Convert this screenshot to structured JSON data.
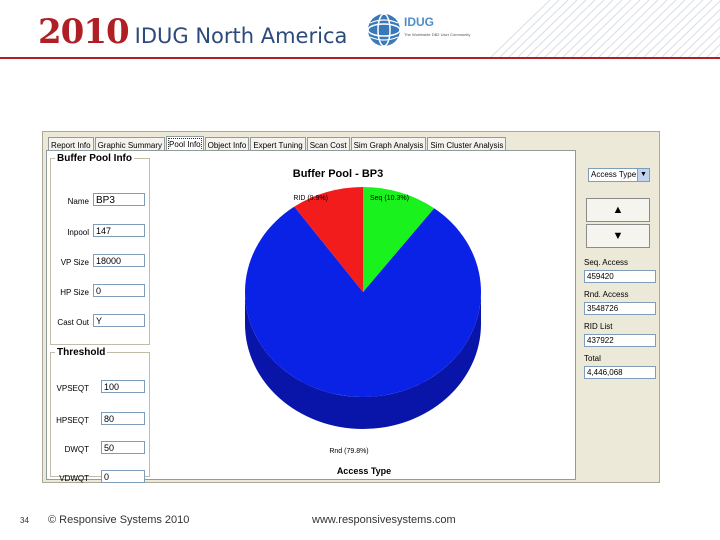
{
  "header": {
    "year": "2010",
    "conference": "IDUG North America",
    "logo_text": "IDUG",
    "logo_tagline": "The Worldwide DB2 User Community"
  },
  "tabs": [
    {
      "label": "Report Info"
    },
    {
      "label": "Graphic Summary"
    },
    {
      "label": "Pool Info",
      "active": true
    },
    {
      "label": "Object Info"
    },
    {
      "label": "Expert Tuning"
    },
    {
      "label": "Scan Cost"
    },
    {
      "label": "Sim Graph Analysis"
    },
    {
      "label": "Sim Cluster Analysis"
    }
  ],
  "buffer_pool_info": {
    "title": "Buffer Pool Info",
    "fields": [
      {
        "label": "Name",
        "value": "BP3"
      },
      {
        "label": "Inpool",
        "value": "147"
      },
      {
        "label": "VP Size",
        "value": "18000"
      },
      {
        "label": "HP Size",
        "value": "0"
      },
      {
        "label": "Cast Out",
        "value": "Y"
      }
    ]
  },
  "threshold": {
    "title": "Threshold",
    "fields": [
      {
        "label": "VPSEQT",
        "value": "100"
      },
      {
        "label": "HPSEQT",
        "value": "80"
      },
      {
        "label": "DWQT",
        "value": "50"
      },
      {
        "label": "VDWQT",
        "value": "0"
      }
    ]
  },
  "chart_data": {
    "type": "pie",
    "title": "Buffer Pool - BP3",
    "xlabel": "Access Type",
    "categories": [
      "Rnd",
      "Seq",
      "RID"
    ],
    "values": [
      79.8,
      10.3,
      9.9
    ],
    "labels": [
      "Rnd (79.8%)",
      "Seq (10.3%)",
      "RID (9.9%)"
    ],
    "colors": [
      "#0a22e6",
      "#19f21c",
      "#f21c1c"
    ],
    "colors_dark": [
      "#0915a8",
      "#12b015",
      "#b01212"
    ],
    "style": "3d"
  },
  "right_panel": {
    "combo_value": "Access Type",
    "up_glyph": "▲",
    "down_glyph": "▼",
    "stats": [
      {
        "label": "Seq. Access",
        "value": "459420"
      },
      {
        "label": "Rnd. Access",
        "value": "3548726"
      },
      {
        "label": "RID List",
        "value": "437922"
      },
      {
        "label": "Total",
        "value": "4,446,068"
      }
    ]
  },
  "footer": {
    "page_number": "34",
    "copyright": "© Responsive Systems 2010",
    "url": "www.responsivesystems.com"
  }
}
